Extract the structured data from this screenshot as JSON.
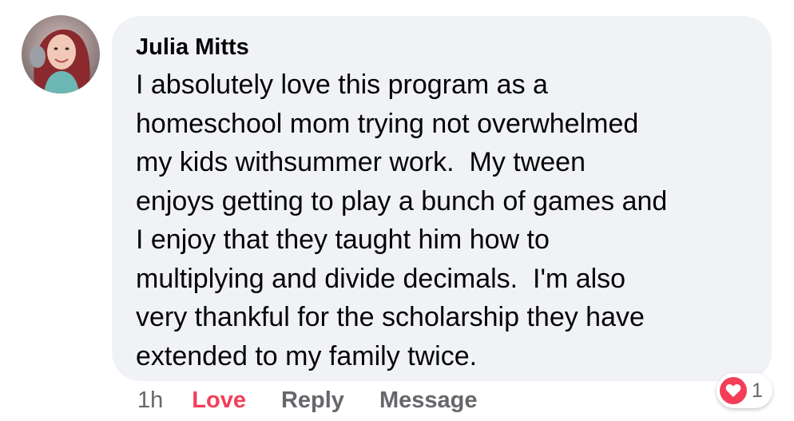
{
  "comment": {
    "author": "Julia Mitts",
    "text": "I absolutely love this program as a\nhomeschool mom trying not overwhelmed\nmy kids withsummer work.  My tween\nenjoys getting to play a bunch of games and\nI enjoy that they taught him how to\nmultiplying and divide decimals.  I'm also\nvery thankful for the scholarship they have\nextended to my family twice."
  },
  "actions": {
    "time": "1h",
    "love_label": "Love",
    "reply_label": "Reply",
    "message_label": "Message"
  },
  "reaction": {
    "icon": "heart-icon",
    "count": "1"
  },
  "colors": {
    "bubble": "#f0f2f5",
    "love": "#f33e58",
    "muted": "#65676b",
    "text": "#050505"
  }
}
